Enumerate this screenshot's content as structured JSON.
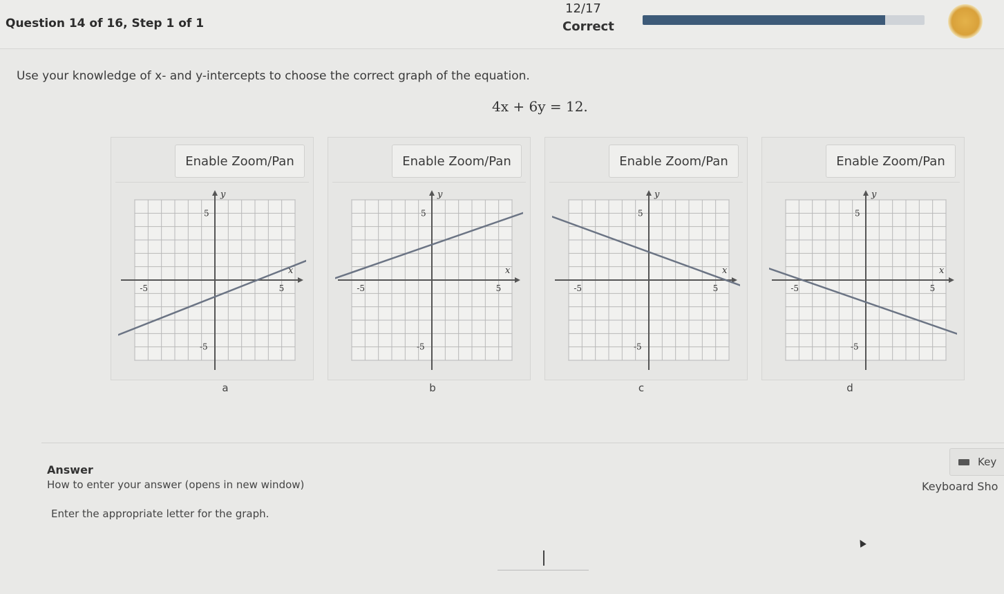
{
  "header": {
    "question_label": "Question 14 of 16, Step 1 of 1",
    "score": "12/17",
    "status": "Correct",
    "progress_fraction": 0.86
  },
  "question": {
    "instruction": "Use your knowledge of x- and y-intercepts to choose the correct graph of the equation.",
    "equation": "4x + 6y = 12."
  },
  "graphs": [
    {
      "zoom_label": "Enable Zoom/Pan",
      "letter": "a",
      "line": {
        "x1": -8.5,
        "y1": -4.6,
        "x2": 8.5,
        "y2": 2.1
      }
    },
    {
      "zoom_label": "Enable Zoom/Pan",
      "letter": "b",
      "line": {
        "x1": -8.5,
        "y1": -0.3,
        "x2": 8.5,
        "y2": 5.6
      }
    },
    {
      "zoom_label": "Enable Zoom/Pan",
      "letter": "c",
      "line": {
        "x1": -8.5,
        "y1": 5.2,
        "x2": 8.5,
        "y2": -1.0
      }
    },
    {
      "zoom_label": "Enable Zoom/Pan",
      "letter": "d",
      "line": {
        "x1": -8.5,
        "y1": 1.3,
        "x2": 8.5,
        "y2": -4.6
      }
    }
  ],
  "axis": {
    "pos_tick": "5",
    "neg_tick": "-5",
    "x_label": "x",
    "y_label": "y",
    "range": [
      -6,
      6
    ]
  },
  "answer": {
    "title": "Answer",
    "how_to": "How to enter your answer (opens in new window)",
    "prompt": "Enter the appropriate letter for the graph.",
    "keyboard_button": "Key",
    "keyboard_shortcuts": "Keyboard Sho",
    "input_value": ""
  }
}
